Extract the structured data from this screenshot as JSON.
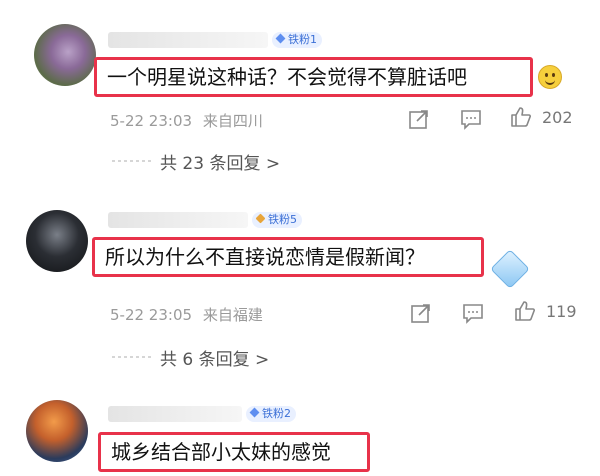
{
  "comments": [
    {
      "badge": "铁粉1",
      "text": "一个明星说这种话？不会觉得不算脏话吧",
      "date": "5-22 23:03",
      "location": "来自四川",
      "likes": "202",
      "replies": "共 23 条回复 >"
    },
    {
      "badge": "铁粉5",
      "text": "所以为什么不直接说恋情是假新闻？",
      "date": "5-22 23:05",
      "location": "来自福建",
      "likes": "119",
      "replies": "共 6 条回复 >"
    },
    {
      "badge": "铁粉2",
      "text": "城乡结合部小太妹的感觉"
    }
  ],
  "icons": {
    "share": "share-icon",
    "comment": "comment-icon",
    "like": "thumbs-up-icon"
  },
  "colors": {
    "highlight_border": "#e8324a",
    "badge_text": "#3b6fd6",
    "meta_text": "#9a9a9a"
  }
}
